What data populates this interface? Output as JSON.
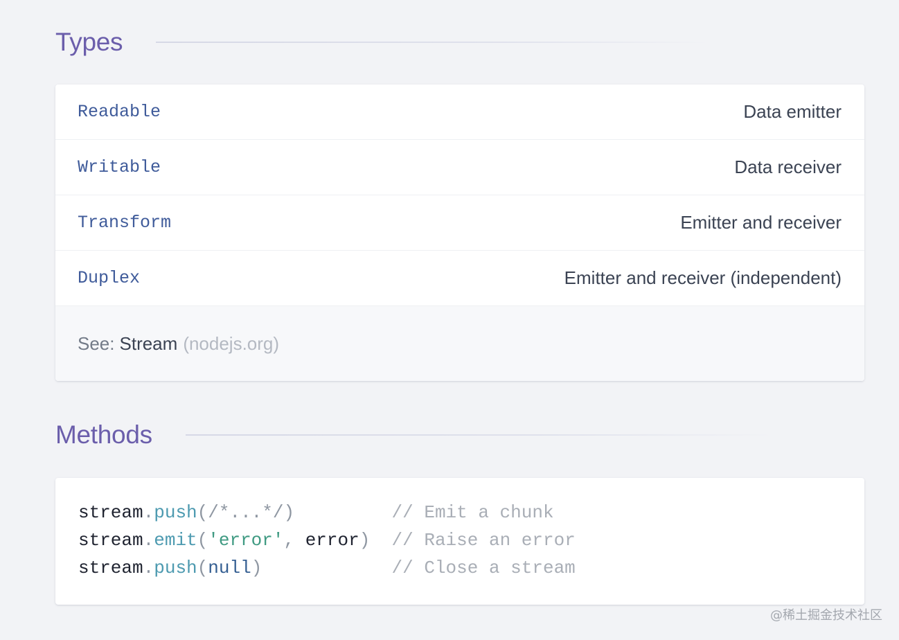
{
  "sections": {
    "types": {
      "title": "Types",
      "rows": [
        {
          "name": "Readable",
          "desc": "Data emitter"
        },
        {
          "name": "Writable",
          "desc": "Data receiver"
        },
        {
          "name": "Transform",
          "desc": "Emitter and receiver"
        },
        {
          "name": "Duplex",
          "desc": "Emitter and receiver (independent)"
        }
      ],
      "footer": {
        "prefix": "See:",
        "link_text": "Stream",
        "domain": "(nodejs.org)"
      }
    },
    "methods": {
      "title": "Methods",
      "code_lines": [
        {
          "obj": "stream",
          "dot": ".",
          "fn": "push",
          "open": "(",
          "args": "/*...*/",
          "close": ")",
          "pad": "         ",
          "comment": "// Emit a chunk"
        },
        {
          "obj": "stream",
          "dot": ".",
          "fn": "emit",
          "open": "(",
          "arg1": "'error'",
          "comma": ", ",
          "arg2": "error",
          "close": ")",
          "pad": "  ",
          "comment": "// Raise an error"
        },
        {
          "obj": "stream",
          "dot": ".",
          "fn": "push",
          "open": "(",
          "args": "null",
          "close": ")",
          "pad": "            ",
          "comment": "// Close a stream"
        }
      ]
    }
  },
  "watermark": "@稀土掘金技术社区"
}
